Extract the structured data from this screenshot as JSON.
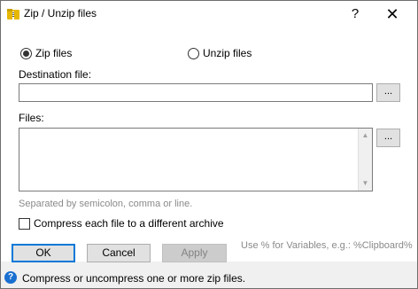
{
  "window": {
    "title": "Zip / Unzip files",
    "help_label": "?",
    "close_label": "✕"
  },
  "mode": {
    "zip_label": "Zip files",
    "unzip_label": "Unzip files",
    "selected": "zip"
  },
  "destination": {
    "label": "Destination file:",
    "value": "",
    "browse_label": "..."
  },
  "files": {
    "label": "Files:",
    "value": "",
    "browse_label": "...",
    "hint": "Separated by semicolon, comma or line."
  },
  "options": {
    "compress_each_label": "Compress each file to a different archive",
    "compress_each_checked": false
  },
  "variables_hint": "Use % for Variables, e.g.: %Clipboard%",
  "buttons": {
    "ok": "OK",
    "cancel": "Cancel",
    "apply": "Apply"
  },
  "status": {
    "icon": "?",
    "text": "Compress or uncompress one or more zip files."
  },
  "colors": {
    "accent": "#0078d7",
    "folder_icon": "#e6b800"
  }
}
